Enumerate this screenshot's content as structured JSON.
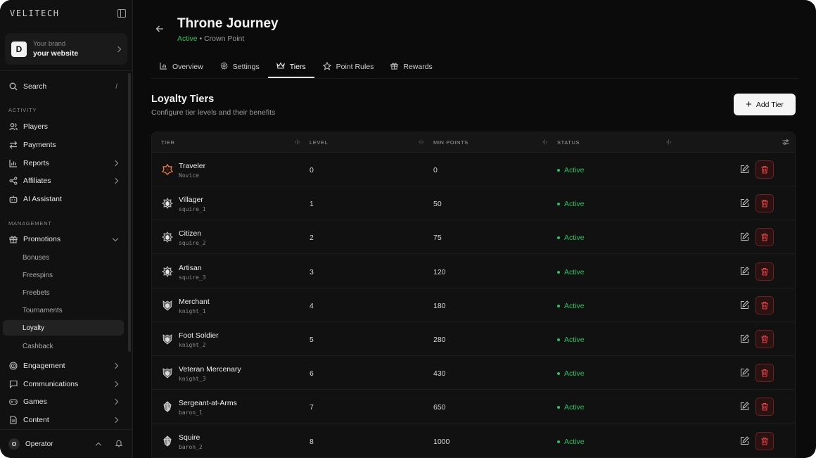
{
  "sidebar": {
    "logo": "VELITECH",
    "brand": {
      "avatar": "D",
      "subtitle": "Your brand",
      "name": "your website"
    },
    "search": {
      "label": "Search",
      "shortcut": "/"
    },
    "sections": {
      "activity": "ACTIVITY",
      "management": "MANAGEMENT"
    },
    "activity_items": [
      {
        "label": "Players",
        "icon": "users-icon"
      },
      {
        "label": "Payments",
        "icon": "arrows-icon"
      },
      {
        "label": "Reports",
        "icon": "chart-icon"
      },
      {
        "label": "Affiliates",
        "icon": "share-icon"
      },
      {
        "label": "AI Assistant",
        "icon": "bot-icon"
      }
    ],
    "promotions": {
      "label": "Promotions",
      "children": [
        "Bonuses",
        "Freespins",
        "Freebets",
        "Tournaments",
        "Loyalty",
        "Cashback"
      ],
      "active": "Loyalty"
    },
    "more_items": [
      {
        "label": "Engagement",
        "icon": "target-icon"
      },
      {
        "label": "Communications",
        "icon": "message-icon"
      },
      {
        "label": "Games",
        "icon": "gamepad-icon"
      },
      {
        "label": "Content",
        "icon": "document-icon"
      }
    ],
    "operator": {
      "avatar": "O",
      "name": "Operator"
    }
  },
  "header": {
    "title": "Throne Journey",
    "status": "Active",
    "subtitle_rest": " • Crown Point"
  },
  "tabs": [
    {
      "label": "Overview",
      "icon": "bar-chart-icon"
    },
    {
      "label": "Settings",
      "icon": "gear-icon"
    },
    {
      "label": "Tiers",
      "icon": "crown-icon",
      "active": true
    },
    {
      "label": "Point Rules",
      "icon": "star-icon"
    },
    {
      "label": "Rewards",
      "icon": "gift-icon"
    }
  ],
  "section": {
    "title": "Loyalty Tiers",
    "description": "Configure tier levels and their benefits",
    "add_button": "Add Tier"
  },
  "table": {
    "columns": [
      "TIER",
      "LEVEL",
      "MIN POINTS",
      "STATUS"
    ],
    "rows": [
      {
        "name": "Traveler",
        "code": "Novice",
        "level": "0",
        "min_points": "0",
        "status": "Active",
        "icon": "novice"
      },
      {
        "name": "Villager",
        "code": "squire_1",
        "level": "1",
        "min_points": "50",
        "status": "Active",
        "icon": "squire"
      },
      {
        "name": "Citizen",
        "code": "squire_2",
        "level": "2",
        "min_points": "75",
        "status": "Active",
        "icon": "squire"
      },
      {
        "name": "Artisan",
        "code": "squire_3",
        "level": "3",
        "min_points": "120",
        "status": "Active",
        "icon": "squire"
      },
      {
        "name": "Merchant",
        "code": "knight_1",
        "level": "4",
        "min_points": "180",
        "status": "Active",
        "icon": "knight"
      },
      {
        "name": "Foot Soldier",
        "code": "knight_2",
        "level": "5",
        "min_points": "280",
        "status": "Active",
        "icon": "knight"
      },
      {
        "name": "Veteran Mercenary",
        "code": "knight_3",
        "level": "6",
        "min_points": "430",
        "status": "Active",
        "icon": "knight"
      },
      {
        "name": "Sergeant-at-Arms",
        "code": "baron_1",
        "level": "7",
        "min_points": "650",
        "status": "Active",
        "icon": "baron"
      },
      {
        "name": "Squire",
        "code": "baron_2",
        "level": "8",
        "min_points": "1000",
        "status": "Active",
        "icon": "baron"
      }
    ]
  },
  "colors": {
    "accent_green": "#22c55e",
    "danger": "#ef4444",
    "background": "#0b0b0b"
  }
}
